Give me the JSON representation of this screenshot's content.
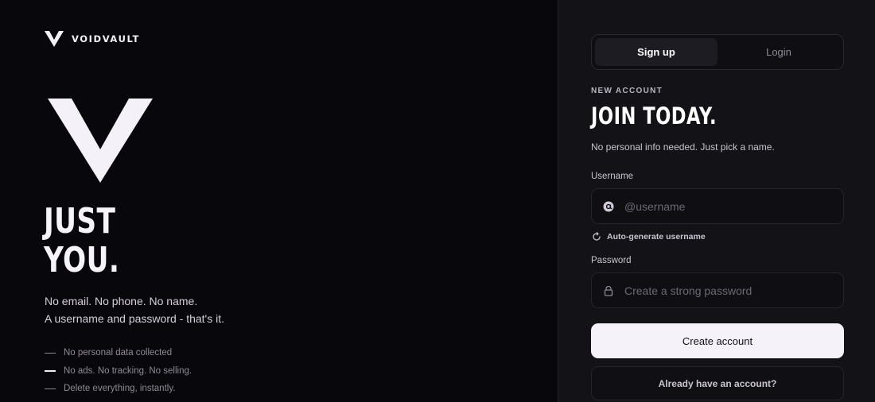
{
  "brand": {
    "name": "VOIDVAULT",
    "logo_icon": "v-logo-icon"
  },
  "hero": {
    "mark_icon": "large-v-mark-icon",
    "headline": [
      "JUST",
      "YOU."
    ],
    "intro": [
      "No email. No phone. No name.",
      "A username and password - that's it."
    ],
    "features": [
      "No personal data collected",
      "No ads. No tracking. No selling.",
      "Delete everything, instantly."
    ]
  },
  "auth": {
    "tabs": [
      {
        "label": "Sign up",
        "active": true
      },
      {
        "label": "Login",
        "active": false
      }
    ],
    "eyebrow": "NEW ACCOUNT",
    "title": "JOIN TODAY.",
    "subtitle": "No personal info needed. Just pick a name.",
    "username": {
      "label": "Username",
      "placeholder": "@username",
      "value": "",
      "icon": "at-sign-icon"
    },
    "autogen": {
      "label": "Auto-generate username",
      "icon": "refresh-icon"
    },
    "password": {
      "label": "Password",
      "placeholder": "Create a strong password",
      "value": "",
      "icon": "lock-icon"
    },
    "submit_label": "Create account",
    "secondary_label": "Already have an account?"
  },
  "colors": {
    "background": "#09070c",
    "panel": "#131217",
    "primary_button": "#f5f3f9",
    "muted_text": "#8e8a95"
  }
}
